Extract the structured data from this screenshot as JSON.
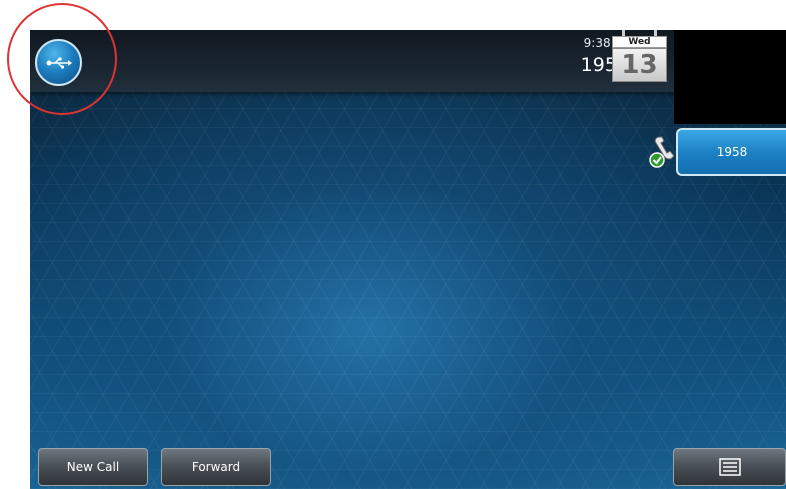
{
  "status_bar": {
    "time": "9:38 AM",
    "extension": "1958",
    "calendar": {
      "day_name": "Wed",
      "day_number": "13"
    }
  },
  "usb_button": {
    "icon": "usb-icon"
  },
  "line_keys": [
    {
      "label": "1958",
      "status_icon": "registered-phone-icon"
    }
  ],
  "softkeys": {
    "new_call": "New Call",
    "forward": "Forward",
    "menu_icon": "menu-icon"
  },
  "annotation": {
    "highlight_color": "#d33333"
  }
}
